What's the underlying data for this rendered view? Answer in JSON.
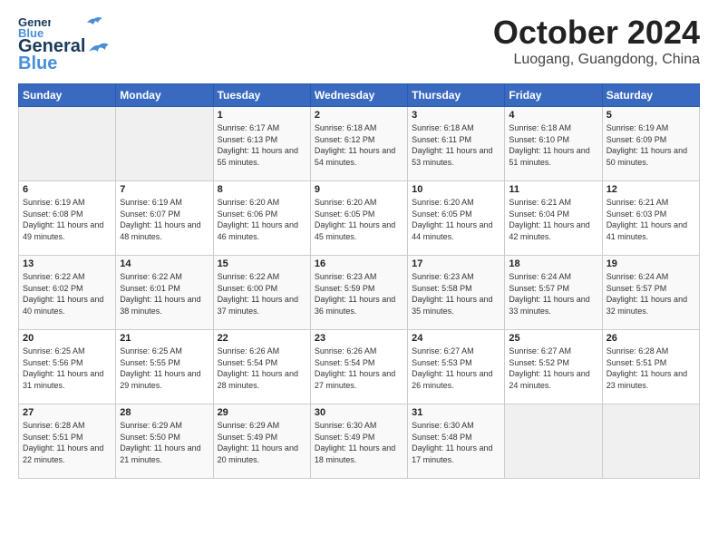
{
  "header": {
    "logo": {
      "line1": "General",
      "line2": "Blue"
    },
    "title": "October 2024",
    "location": "Luogang, Guangdong, China"
  },
  "weekdays": [
    "Sunday",
    "Monday",
    "Tuesday",
    "Wednesday",
    "Thursday",
    "Friday",
    "Saturday"
  ],
  "weeks": [
    [
      {
        "day": "",
        "info": ""
      },
      {
        "day": "",
        "info": ""
      },
      {
        "day": "1",
        "info": "Sunrise: 6:17 AM\nSunset: 6:13 PM\nDaylight: 11 hours and 55 minutes."
      },
      {
        "day": "2",
        "info": "Sunrise: 6:18 AM\nSunset: 6:12 PM\nDaylight: 11 hours and 54 minutes."
      },
      {
        "day": "3",
        "info": "Sunrise: 6:18 AM\nSunset: 6:11 PM\nDaylight: 11 hours and 53 minutes."
      },
      {
        "day": "4",
        "info": "Sunrise: 6:18 AM\nSunset: 6:10 PM\nDaylight: 11 hours and 51 minutes."
      },
      {
        "day": "5",
        "info": "Sunrise: 6:19 AM\nSunset: 6:09 PM\nDaylight: 11 hours and 50 minutes."
      }
    ],
    [
      {
        "day": "6",
        "info": "Sunrise: 6:19 AM\nSunset: 6:08 PM\nDaylight: 11 hours and 49 minutes."
      },
      {
        "day": "7",
        "info": "Sunrise: 6:19 AM\nSunset: 6:07 PM\nDaylight: 11 hours and 48 minutes."
      },
      {
        "day": "8",
        "info": "Sunrise: 6:20 AM\nSunset: 6:06 PM\nDaylight: 11 hours and 46 minutes."
      },
      {
        "day": "9",
        "info": "Sunrise: 6:20 AM\nSunset: 6:05 PM\nDaylight: 11 hours and 45 minutes."
      },
      {
        "day": "10",
        "info": "Sunrise: 6:20 AM\nSunset: 6:05 PM\nDaylight: 11 hours and 44 minutes."
      },
      {
        "day": "11",
        "info": "Sunrise: 6:21 AM\nSunset: 6:04 PM\nDaylight: 11 hours and 42 minutes."
      },
      {
        "day": "12",
        "info": "Sunrise: 6:21 AM\nSunset: 6:03 PM\nDaylight: 11 hours and 41 minutes."
      }
    ],
    [
      {
        "day": "13",
        "info": "Sunrise: 6:22 AM\nSunset: 6:02 PM\nDaylight: 11 hours and 40 minutes."
      },
      {
        "day": "14",
        "info": "Sunrise: 6:22 AM\nSunset: 6:01 PM\nDaylight: 11 hours and 38 minutes."
      },
      {
        "day": "15",
        "info": "Sunrise: 6:22 AM\nSunset: 6:00 PM\nDaylight: 11 hours and 37 minutes."
      },
      {
        "day": "16",
        "info": "Sunrise: 6:23 AM\nSunset: 5:59 PM\nDaylight: 11 hours and 36 minutes."
      },
      {
        "day": "17",
        "info": "Sunrise: 6:23 AM\nSunset: 5:58 PM\nDaylight: 11 hours and 35 minutes."
      },
      {
        "day": "18",
        "info": "Sunrise: 6:24 AM\nSunset: 5:57 PM\nDaylight: 11 hours and 33 minutes."
      },
      {
        "day": "19",
        "info": "Sunrise: 6:24 AM\nSunset: 5:57 PM\nDaylight: 11 hours and 32 minutes."
      }
    ],
    [
      {
        "day": "20",
        "info": "Sunrise: 6:25 AM\nSunset: 5:56 PM\nDaylight: 11 hours and 31 minutes."
      },
      {
        "day": "21",
        "info": "Sunrise: 6:25 AM\nSunset: 5:55 PM\nDaylight: 11 hours and 29 minutes."
      },
      {
        "day": "22",
        "info": "Sunrise: 6:26 AM\nSunset: 5:54 PM\nDaylight: 11 hours and 28 minutes."
      },
      {
        "day": "23",
        "info": "Sunrise: 6:26 AM\nSunset: 5:54 PM\nDaylight: 11 hours and 27 minutes."
      },
      {
        "day": "24",
        "info": "Sunrise: 6:27 AM\nSunset: 5:53 PM\nDaylight: 11 hours and 26 minutes."
      },
      {
        "day": "25",
        "info": "Sunrise: 6:27 AM\nSunset: 5:52 PM\nDaylight: 11 hours and 24 minutes."
      },
      {
        "day": "26",
        "info": "Sunrise: 6:28 AM\nSunset: 5:51 PM\nDaylight: 11 hours and 23 minutes."
      }
    ],
    [
      {
        "day": "27",
        "info": "Sunrise: 6:28 AM\nSunset: 5:51 PM\nDaylight: 11 hours and 22 minutes."
      },
      {
        "day": "28",
        "info": "Sunrise: 6:29 AM\nSunset: 5:50 PM\nDaylight: 11 hours and 21 minutes."
      },
      {
        "day": "29",
        "info": "Sunrise: 6:29 AM\nSunset: 5:49 PM\nDaylight: 11 hours and 20 minutes."
      },
      {
        "day": "30",
        "info": "Sunrise: 6:30 AM\nSunset: 5:49 PM\nDaylight: 11 hours and 18 minutes."
      },
      {
        "day": "31",
        "info": "Sunrise: 6:30 AM\nSunset: 5:48 PM\nDaylight: 11 hours and 17 minutes."
      },
      {
        "day": "",
        "info": ""
      },
      {
        "day": "",
        "info": ""
      }
    ]
  ]
}
